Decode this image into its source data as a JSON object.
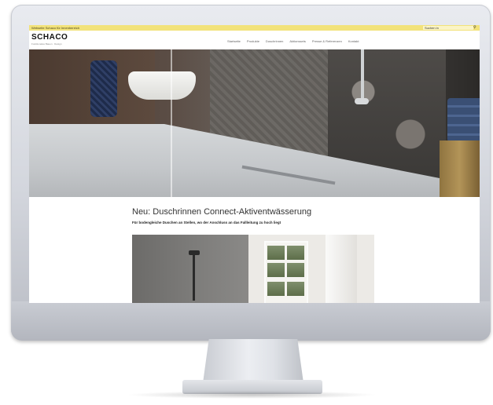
{
  "topbar": {
    "text": "Webseite Schaco für Innenbereich",
    "search_placeholder": "Suchen in",
    "background": "#f2e27a"
  },
  "header": {
    "logo": "SCHACO",
    "logo_sub": "Funktionales Bauen · Design",
    "nav": [
      "Startseite",
      "Produkte",
      "Duschrinnen",
      "Aktionssets",
      "Presse & Referenzen",
      "Kontakt"
    ]
  },
  "content": {
    "headline": "Neu: Duschrinnen Connect-Aktiventwässerung",
    "subline": "Für bodengleiche Duschen an Stellen, wo der Anschluss an das Fallleitung zu hoch liegt"
  },
  "icons": {
    "search": "search-icon"
  }
}
